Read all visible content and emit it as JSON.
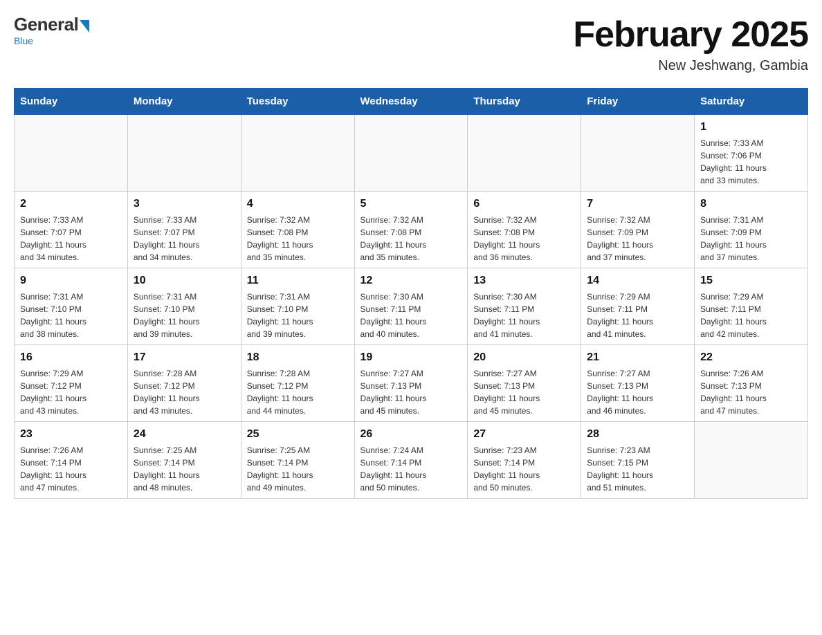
{
  "header": {
    "logo": {
      "general": "General",
      "blue": "Blue",
      "subtitle": "Blue"
    },
    "title": "February 2025",
    "subtitle": "New Jeshwang, Gambia"
  },
  "weekdays": [
    "Sunday",
    "Monday",
    "Tuesday",
    "Wednesday",
    "Thursday",
    "Friday",
    "Saturday"
  ],
  "weeks": [
    [
      {
        "day": "",
        "info": ""
      },
      {
        "day": "",
        "info": ""
      },
      {
        "day": "",
        "info": ""
      },
      {
        "day": "",
        "info": ""
      },
      {
        "day": "",
        "info": ""
      },
      {
        "day": "",
        "info": ""
      },
      {
        "day": "1",
        "info": "Sunrise: 7:33 AM\nSunset: 7:06 PM\nDaylight: 11 hours\nand 33 minutes."
      }
    ],
    [
      {
        "day": "2",
        "info": "Sunrise: 7:33 AM\nSunset: 7:07 PM\nDaylight: 11 hours\nand 34 minutes."
      },
      {
        "day": "3",
        "info": "Sunrise: 7:33 AM\nSunset: 7:07 PM\nDaylight: 11 hours\nand 34 minutes."
      },
      {
        "day": "4",
        "info": "Sunrise: 7:32 AM\nSunset: 7:08 PM\nDaylight: 11 hours\nand 35 minutes."
      },
      {
        "day": "5",
        "info": "Sunrise: 7:32 AM\nSunset: 7:08 PM\nDaylight: 11 hours\nand 35 minutes."
      },
      {
        "day": "6",
        "info": "Sunrise: 7:32 AM\nSunset: 7:08 PM\nDaylight: 11 hours\nand 36 minutes."
      },
      {
        "day": "7",
        "info": "Sunrise: 7:32 AM\nSunset: 7:09 PM\nDaylight: 11 hours\nand 37 minutes."
      },
      {
        "day": "8",
        "info": "Sunrise: 7:31 AM\nSunset: 7:09 PM\nDaylight: 11 hours\nand 37 minutes."
      }
    ],
    [
      {
        "day": "9",
        "info": "Sunrise: 7:31 AM\nSunset: 7:10 PM\nDaylight: 11 hours\nand 38 minutes."
      },
      {
        "day": "10",
        "info": "Sunrise: 7:31 AM\nSunset: 7:10 PM\nDaylight: 11 hours\nand 39 minutes."
      },
      {
        "day": "11",
        "info": "Sunrise: 7:31 AM\nSunset: 7:10 PM\nDaylight: 11 hours\nand 39 minutes."
      },
      {
        "day": "12",
        "info": "Sunrise: 7:30 AM\nSunset: 7:11 PM\nDaylight: 11 hours\nand 40 minutes."
      },
      {
        "day": "13",
        "info": "Sunrise: 7:30 AM\nSunset: 7:11 PM\nDaylight: 11 hours\nand 41 minutes."
      },
      {
        "day": "14",
        "info": "Sunrise: 7:29 AM\nSunset: 7:11 PM\nDaylight: 11 hours\nand 41 minutes."
      },
      {
        "day": "15",
        "info": "Sunrise: 7:29 AM\nSunset: 7:11 PM\nDaylight: 11 hours\nand 42 minutes."
      }
    ],
    [
      {
        "day": "16",
        "info": "Sunrise: 7:29 AM\nSunset: 7:12 PM\nDaylight: 11 hours\nand 43 minutes."
      },
      {
        "day": "17",
        "info": "Sunrise: 7:28 AM\nSunset: 7:12 PM\nDaylight: 11 hours\nand 43 minutes."
      },
      {
        "day": "18",
        "info": "Sunrise: 7:28 AM\nSunset: 7:12 PM\nDaylight: 11 hours\nand 44 minutes."
      },
      {
        "day": "19",
        "info": "Sunrise: 7:27 AM\nSunset: 7:13 PM\nDaylight: 11 hours\nand 45 minutes."
      },
      {
        "day": "20",
        "info": "Sunrise: 7:27 AM\nSunset: 7:13 PM\nDaylight: 11 hours\nand 45 minutes."
      },
      {
        "day": "21",
        "info": "Sunrise: 7:27 AM\nSunset: 7:13 PM\nDaylight: 11 hours\nand 46 minutes."
      },
      {
        "day": "22",
        "info": "Sunrise: 7:26 AM\nSunset: 7:13 PM\nDaylight: 11 hours\nand 47 minutes."
      }
    ],
    [
      {
        "day": "23",
        "info": "Sunrise: 7:26 AM\nSunset: 7:14 PM\nDaylight: 11 hours\nand 47 minutes."
      },
      {
        "day": "24",
        "info": "Sunrise: 7:25 AM\nSunset: 7:14 PM\nDaylight: 11 hours\nand 48 minutes."
      },
      {
        "day": "25",
        "info": "Sunrise: 7:25 AM\nSunset: 7:14 PM\nDaylight: 11 hours\nand 49 minutes."
      },
      {
        "day": "26",
        "info": "Sunrise: 7:24 AM\nSunset: 7:14 PM\nDaylight: 11 hours\nand 50 minutes."
      },
      {
        "day": "27",
        "info": "Sunrise: 7:23 AM\nSunset: 7:14 PM\nDaylight: 11 hours\nand 50 minutes."
      },
      {
        "day": "28",
        "info": "Sunrise: 7:23 AM\nSunset: 7:15 PM\nDaylight: 11 hours\nand 51 minutes."
      },
      {
        "day": "",
        "info": ""
      }
    ]
  ]
}
